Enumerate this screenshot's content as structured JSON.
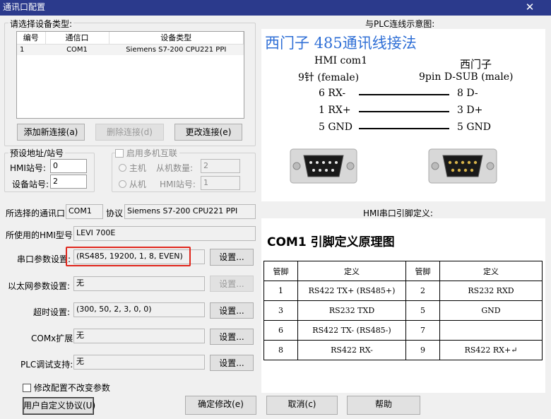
{
  "window": {
    "title": "通讯口配置",
    "close_glyph": "✕"
  },
  "device_group": {
    "title": "请选择设备类型:",
    "columns": [
      "编号",
      "通信口",
      "设备类型"
    ],
    "rows": [
      {
        "no": "1",
        "port": "COM1",
        "device": "Siemens S7-200 CPU221 PPI"
      }
    ],
    "buttons": {
      "add": "添加新连接(a)",
      "delete": "删除连接(d)",
      "change": "更改连接(e)"
    }
  },
  "preset": {
    "title": "预设地址/站号",
    "hmi_label": "HMI站号:",
    "hmi_value": "0",
    "device_label": "设备站号:",
    "device_value": "2"
  },
  "multi": {
    "title": "启用多机互联",
    "master": "主机",
    "slave_count_label": "从机数量:",
    "slave_count": "2",
    "slave": "从机",
    "hmi_station_label": "HMI站号:",
    "hmi_station": "1"
  },
  "selected": {
    "port_label": "所选择的通讯口",
    "port_value": "COM1",
    "protocol_label": "协议",
    "protocol_value": "Siemens S7-200 CPU221 PPI"
  },
  "hmi_model": {
    "label": "所使用的HMI型号",
    "value": "LEVI 700E"
  },
  "serial": {
    "label": "串口参数设置:",
    "value": "(RS485, 19200, 1, 8, EVEN)",
    "button": "设置..."
  },
  "ethernet": {
    "label": "以太网参数设置:",
    "value": "无",
    "button": "设置..."
  },
  "timeout": {
    "label": "超时设置:",
    "value": "(300, 50, 2, 3, 0, 0)",
    "button": "设置..."
  },
  "comx": {
    "label": "COMx扩展:",
    "value": "无",
    "button": "设置..."
  },
  "plc_debug": {
    "label": "PLC调试支持:",
    "value": "无",
    "button": "设置..."
  },
  "keep_params": {
    "label": "修改配置不改变参数"
  },
  "bottom_buttons": {
    "custom": "用户自定义协议(U)",
    "ok": "确定修改(e)",
    "cancel": "取消(c)",
    "help": "帮助"
  },
  "wiring": {
    "title": "与PLC连线示意图:",
    "heading": "西门子 485通讯线接法",
    "left_title": "HMI com1",
    "left_sub": "9针 (female)",
    "right_title": "西门子",
    "right_sub": "9pin D-SUB (male)",
    "lines": [
      {
        "left": "6 RX-",
        "right": "8 D-"
      },
      {
        "left": "1 RX+",
        "right": "3 D+"
      },
      {
        "left": "5 GND",
        "right": "5 GND"
      }
    ]
  },
  "pin_def": {
    "title": "HMI串口引脚定义:",
    "heading": "COM1 引脚定义原理图",
    "headers": [
      "管脚",
      "定义",
      "管脚",
      "定义"
    ],
    "rows": [
      [
        "1",
        "RS422 TX+ (RS485+)",
        "2",
        "RS232 RXD"
      ],
      [
        "3",
        "RS232 TXD",
        "5",
        "GND"
      ],
      [
        "6",
        "RS422 TX- (RS485-)",
        "7",
        ""
      ],
      [
        "8",
        "RS422 RX-",
        "9",
        "RS422 RX+↵"
      ]
    ]
  },
  "colors": {
    "titlebar": "#2b3a8c",
    "highlight": "#e0251b",
    "diagram_heading": "#2f6fd6"
  }
}
